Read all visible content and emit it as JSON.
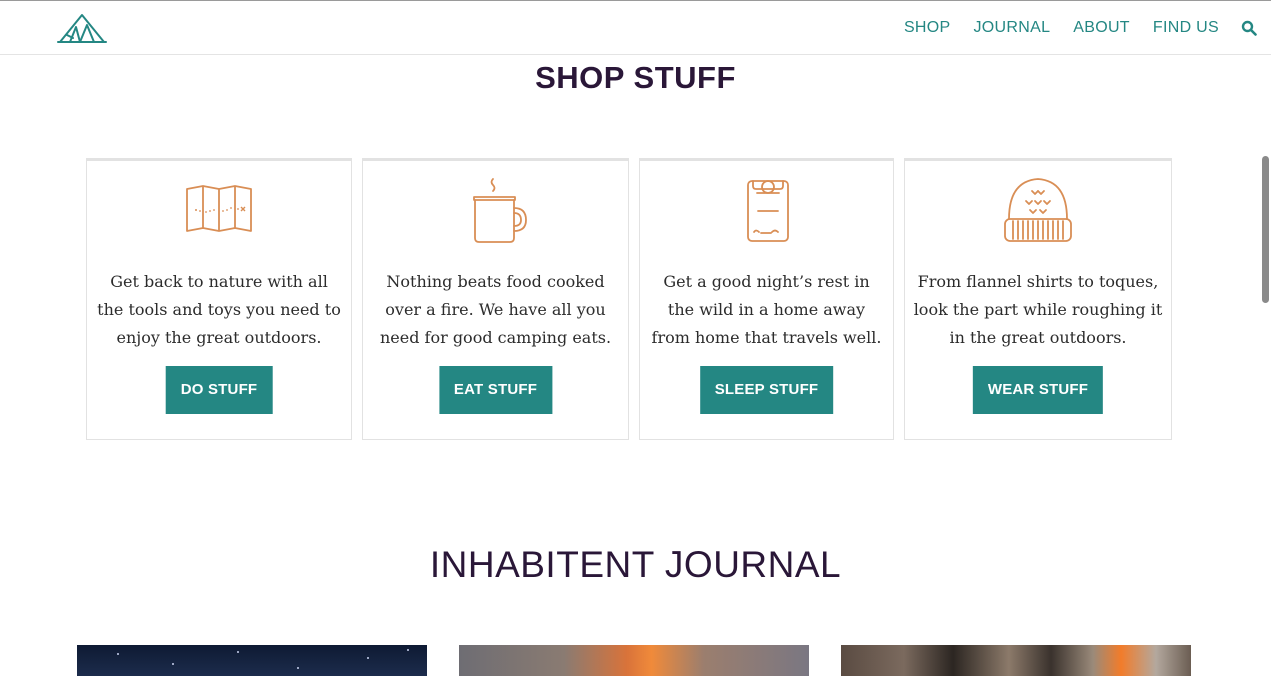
{
  "header": {
    "nav": [
      "SHOP",
      "JOURNAL",
      "ABOUT",
      "FIND US"
    ]
  },
  "shop": {
    "title": "SHOP STUFF",
    "cards": [
      {
        "icon": "map-icon",
        "text": "Get back to nature with all the tools and toys you need to enjoy the great outdoors.",
        "button": "DO STUFF"
      },
      {
        "icon": "mug-icon",
        "text": "Nothing beats food cooked over a fire. We have all you need for good camping eats.",
        "button": "EAT STUFF"
      },
      {
        "icon": "sleeping-bag-icon",
        "text": "Get a good night’s rest in the wild in a home away from home that travels well.",
        "button": "SLEEP STUFF"
      },
      {
        "icon": "toque-icon",
        "text": "From flannel shirts to toques, look the part while roughing it in the great outdoors.",
        "button": "WEAR STUFF"
      }
    ]
  },
  "journal": {
    "title": "INHABITENT JOURNAL"
  },
  "colors": {
    "accent": "#248783",
    "heading": "#2a1738",
    "icon": "#d98e55",
    "text": "#2c2c2c"
  }
}
